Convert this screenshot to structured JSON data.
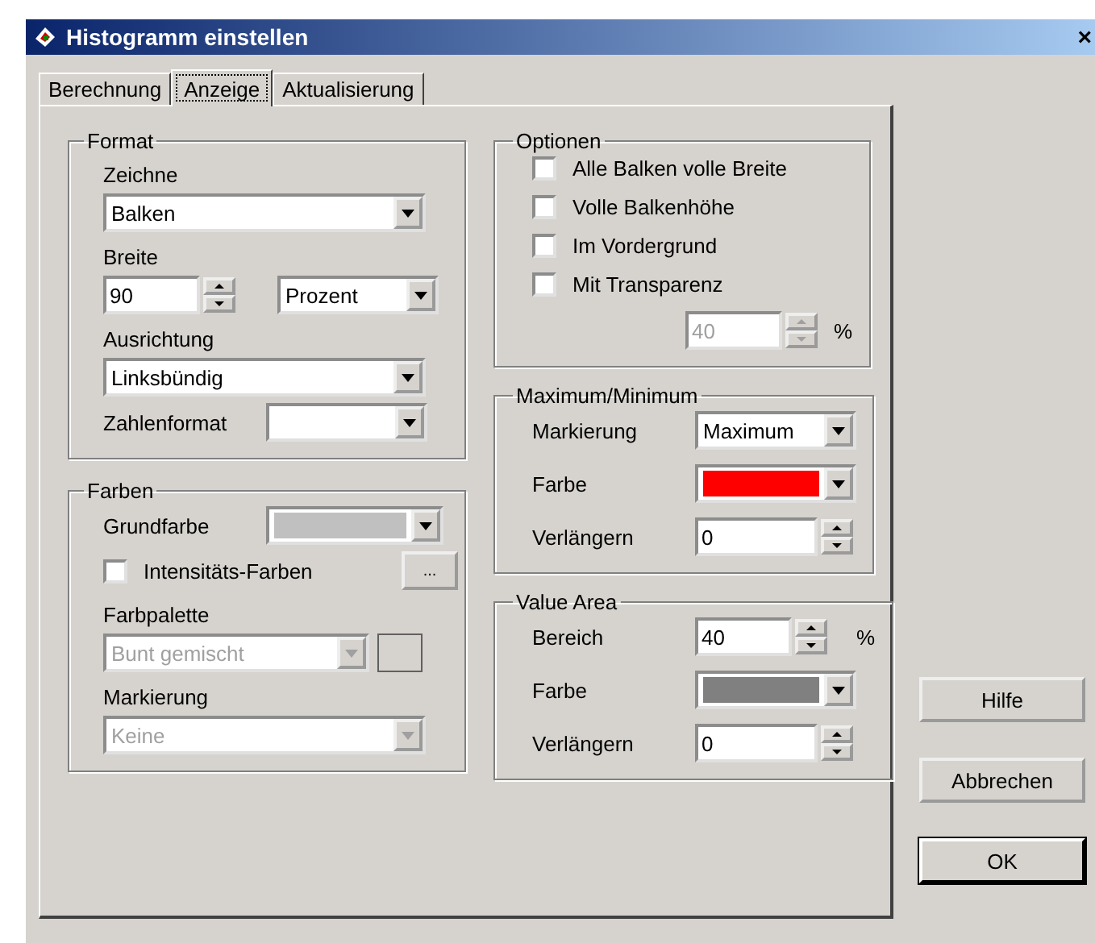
{
  "window": {
    "title": "Histogramm einstellen",
    "close": "×"
  },
  "tabs": [
    {
      "label": "Berechnung",
      "selected": false
    },
    {
      "label": "Anzeige",
      "selected": true
    },
    {
      "label": "Aktualisierung",
      "selected": false
    }
  ],
  "panel": {
    "left_groups": [
      {
        "title": "Format",
        "rows": [
          {
            "kind": "label",
            "text": "Zeichne"
          },
          {
            "kind": "select",
            "value": "Balken",
            "disabled": false
          },
          {
            "kind": "label",
            "text": "Breite"
          },
          {
            "kind": "spin_select",
            "spin": {
              "value": "90",
              "disabled": false
            },
            "select": {
              "value": "Prozent",
              "disabled": false
            }
          },
          {
            "kind": "label",
            "text": "Ausrichtung"
          },
          {
            "kind": "select",
            "value": "Linksbündig",
            "disabled": false
          },
          {
            "kind": "labeled_select",
            "label": "Zahlenformat",
            "select": {
              "disabled": false
            }
          }
        ]
      },
      {
        "title": "Farben",
        "rows": [
          {
            "kind": "labeled_color",
            "label": "Grundfarbe",
            "color": "#c0c0c0"
          },
          {
            "kind": "checkbox_button",
            "label": "Intensitäts-Farben",
            "checked": false,
            "button": "..."
          },
          {
            "kind": "label",
            "text": "Farbpalette"
          },
          {
            "kind": "select_swatch",
            "value": "Bunt gemischt",
            "disabled": true
          },
          {
            "kind": "label",
            "text": "Markierung"
          },
          {
            "kind": "select",
            "value": "Keine",
            "disabled": true
          }
        ]
      }
    ],
    "right_groups": [
      {
        "title": "Optionen",
        "rows": [
          {
            "kind": "checkbox",
            "label": "Alle Balken volle Breite",
            "checked": false
          },
          {
            "kind": "checkbox",
            "label": "Volle Balkenhöhe",
            "checked": false
          },
          {
            "kind": "checkbox",
            "label": "Im Vordergrund",
            "checked": false
          },
          {
            "kind": "checkbox",
            "label": "Mit Transparenz",
            "checked": false
          },
          {
            "kind": "spin_unit",
            "value": "40",
            "unit": "%",
            "disabled": true
          }
        ]
      },
      {
        "title": "Maximum/Minimum",
        "rows": [
          {
            "kind": "labeled_select",
            "label": "Markierung",
            "select": {
              "value": "Maximum",
              "disabled": false
            }
          },
          {
            "kind": "labeled_color",
            "label": "Farbe",
            "color": "#ff0000"
          },
          {
            "kind": "labeled_spin",
            "label": "Verlängern",
            "value": "0",
            "disabled": false
          }
        ]
      },
      {
        "title": "Value Area",
        "rows": [
          {
            "kind": "labeled_spin",
            "label": "Bereich",
            "value": "40",
            "unit": "%",
            "disabled": false
          },
          {
            "kind": "labeled_color",
            "label": "Farbe",
            "color": "#808080"
          },
          {
            "kind": "labeled_spin",
            "label": "Verlängern",
            "value": "0",
            "disabled": false
          }
        ]
      }
    ]
  },
  "buttons": [
    {
      "label": "Hilfe",
      "default": false
    },
    {
      "label": "Abbrechen",
      "default": false
    },
    {
      "label": "OK",
      "default": true
    }
  ]
}
